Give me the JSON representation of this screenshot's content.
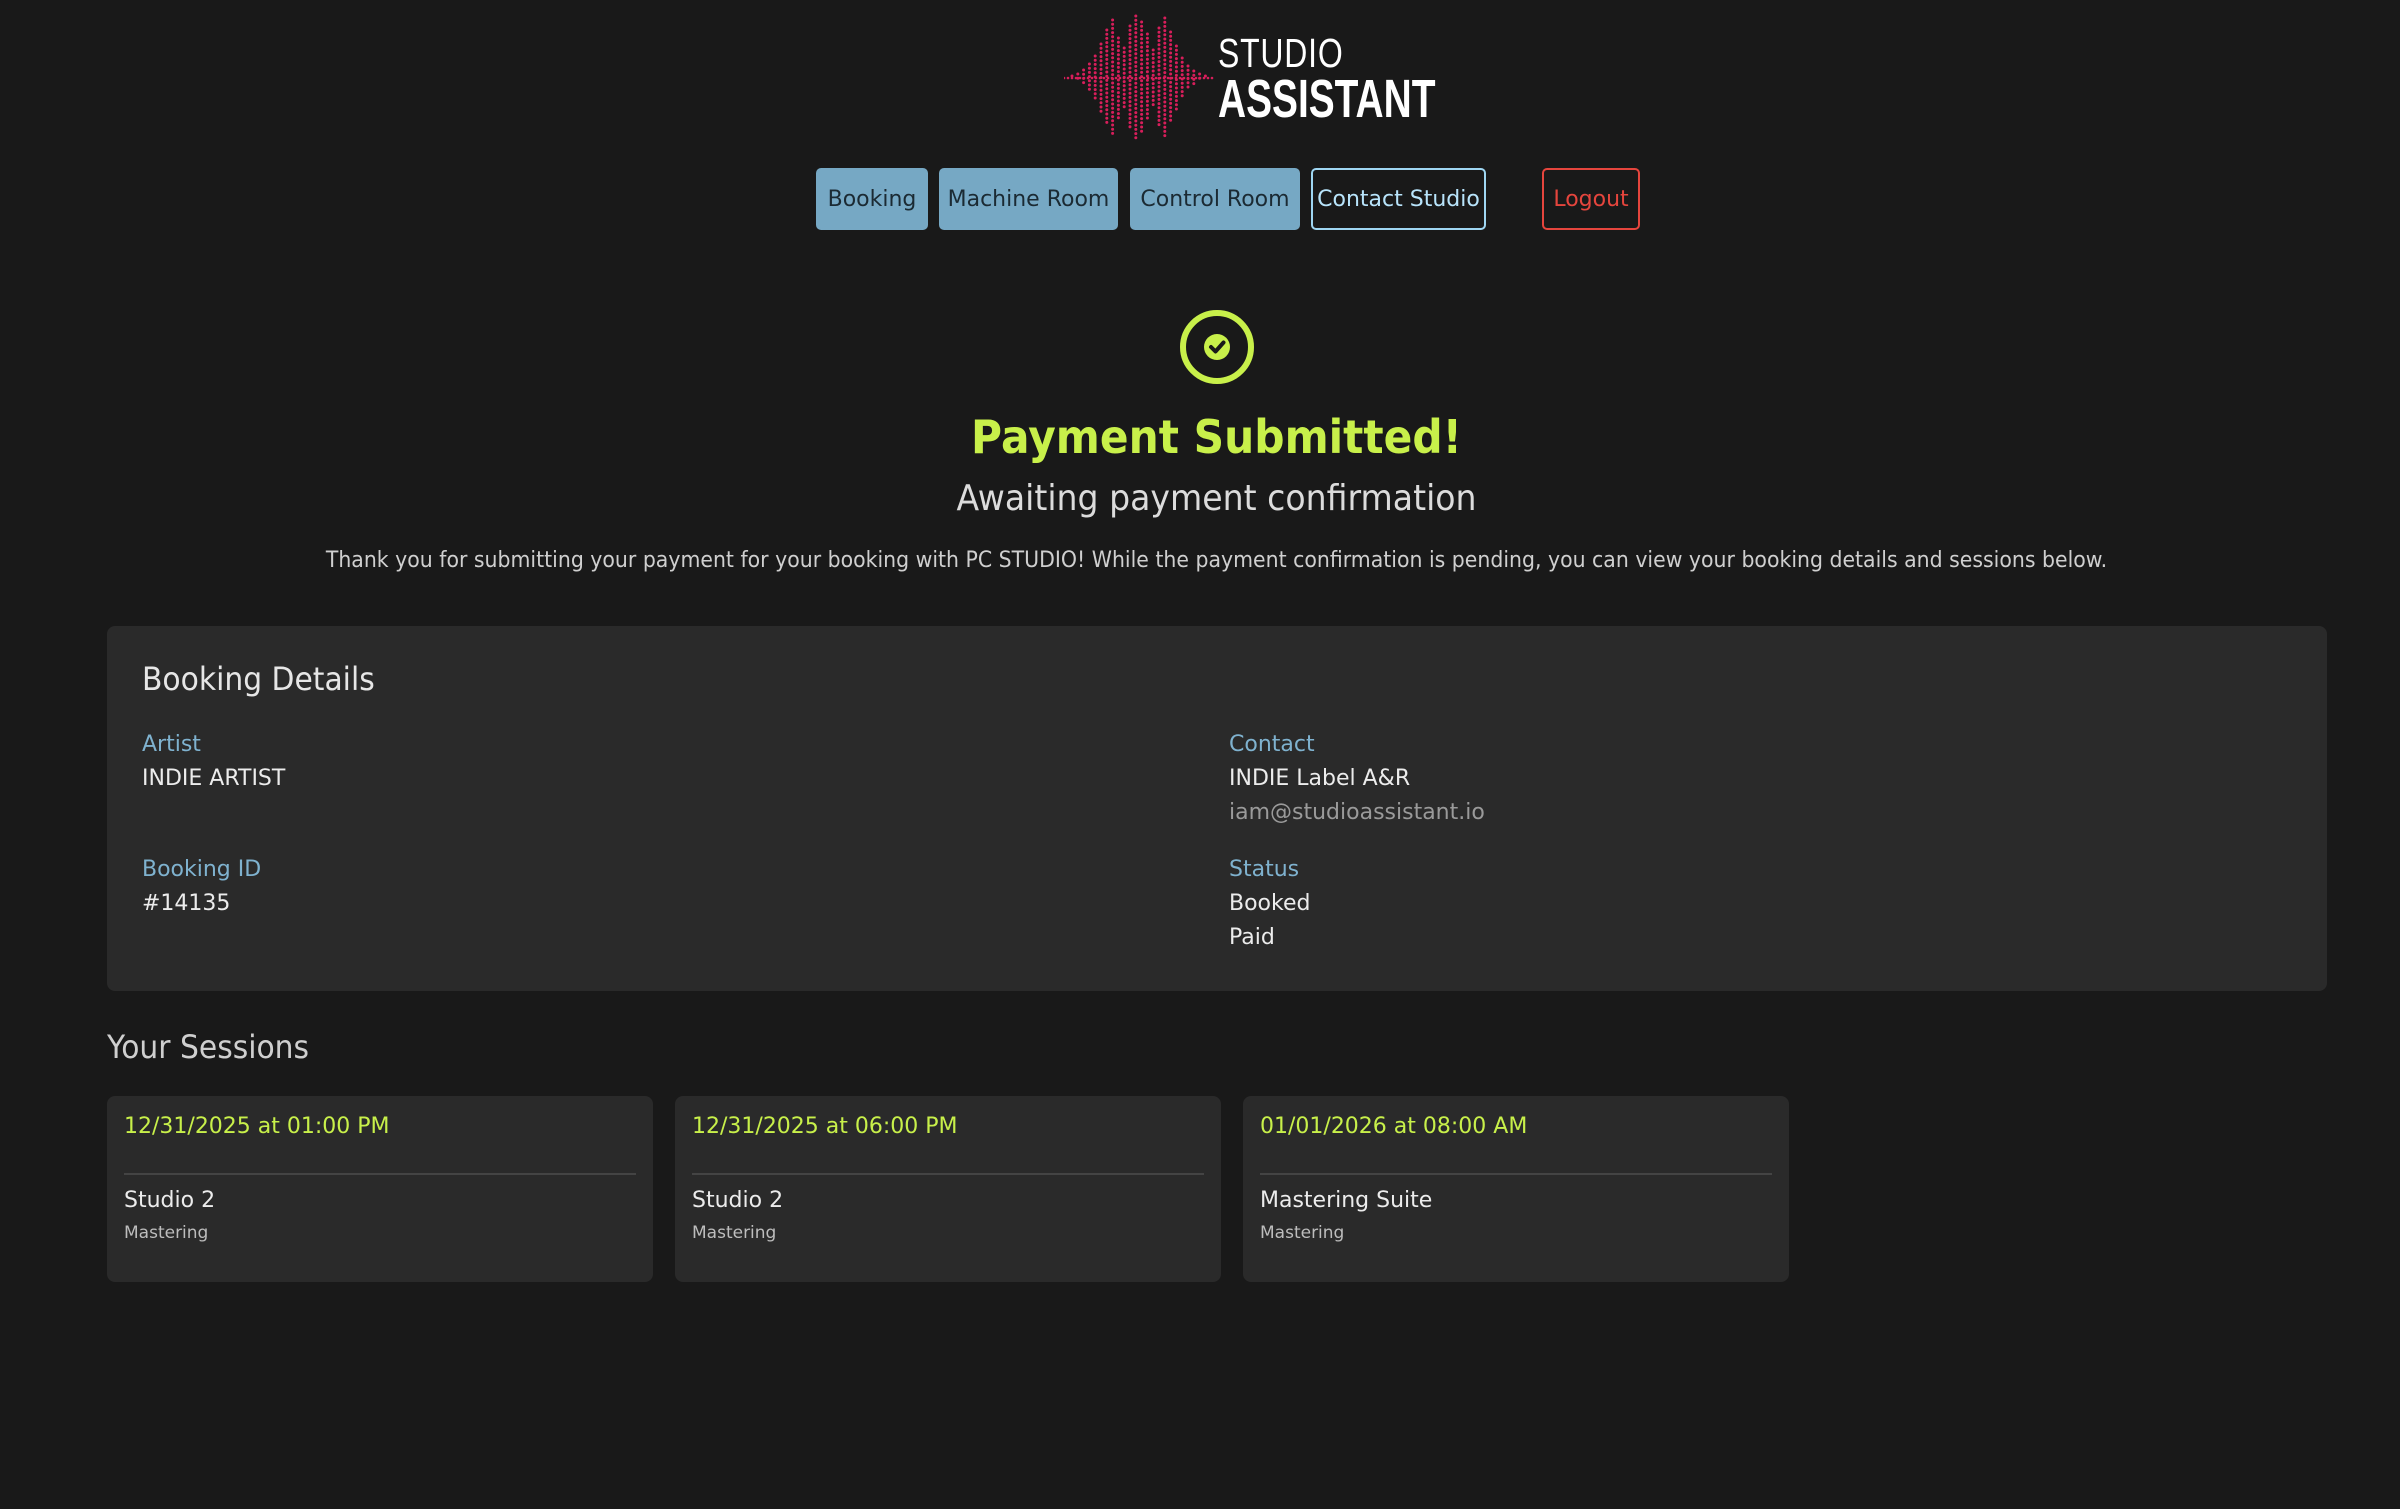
{
  "logo": {
    "line1": "STUDIO",
    "line2": "ASSISTANT",
    "accent_color": "#d81e5b"
  },
  "nav": {
    "booking": "Booking",
    "machine_room": "Machine Room",
    "control_room": "Control Room",
    "contact_studio": "Contact Studio",
    "logout": "Logout"
  },
  "success": {
    "icon": "check-circle-icon",
    "title": "Payment Submitted!",
    "subtitle": "Awaiting payment confirmation",
    "message": "Thank you for submitting your payment for your booking with PC STUDIO! While the payment confirmation is pending, you can view your booking details and sessions below."
  },
  "booking": {
    "heading": "Booking Details",
    "artist_label": "Artist",
    "artist": "INDIE ARTIST",
    "booking_id_label": "Booking ID",
    "booking_id": "#14135",
    "contact_label": "Contact",
    "contact_name": "INDIE Label A&R",
    "contact_email": "iam@studioassistant.io",
    "status_label": "Status",
    "status": "Booked",
    "payment_status": "Paid"
  },
  "sessions": {
    "heading": "Your Sessions",
    "items": [
      {
        "datetime": "12/31/2025 at 01:00 PM",
        "room": "Studio 2",
        "type": "Mastering"
      },
      {
        "datetime": "12/31/2025 at 06:00 PM",
        "room": "Studio 2",
        "type": "Mastering"
      },
      {
        "datetime": "01/01/2026 at 08:00 AM",
        "room": "Mastering Suite",
        "type": "Mastering"
      }
    ]
  },
  "colors": {
    "background": "#191919",
    "card": "#2a2a2a",
    "success": "#c8f04a",
    "nav_fill": "#76a8c4",
    "danger": "#e5453d",
    "label": "#7fb2cf"
  }
}
